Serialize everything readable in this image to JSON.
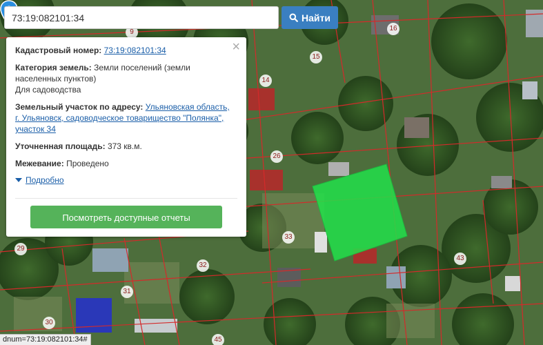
{
  "search": {
    "value": "73:19:082101:34",
    "button_label": "Найти"
  },
  "info_panel": {
    "cadastral_label": "Кадастровый номер:",
    "cadastral_value": "73:19:082101:34",
    "category_label": "Категория земель:",
    "category_value_line1": "Земли поселений (земли",
    "category_value_line2": "населенных пунктов)",
    "category_use": "Для садоводства",
    "address_label": "Земельный участок по адресу:",
    "address_line1": "Ульяновская область,",
    "address_line2": "г. Ульяновск, садоводческое товарищество \"Полянка\",",
    "address_line3": "участок 34",
    "area_label": "Уточненная площадь:",
    "area_value": "373 кв.м.",
    "survey_label": "Межевание:",
    "survey_value": "Проведено",
    "more_link": "Подробно",
    "reports_button": "Посмотреть доступные отчеты",
    "close_symbol": "×"
  },
  "map": {
    "plot_numbers": [
      "9",
      "16",
      "15",
      "14",
      "26",
      "33",
      "43",
      "29",
      "32",
      "31",
      "30",
      "45"
    ],
    "highlight_color": "#22e04a",
    "boundary_color": "#d42a2a"
  },
  "status_bar": {
    "text": "dnum=73:19:082101:34#"
  }
}
